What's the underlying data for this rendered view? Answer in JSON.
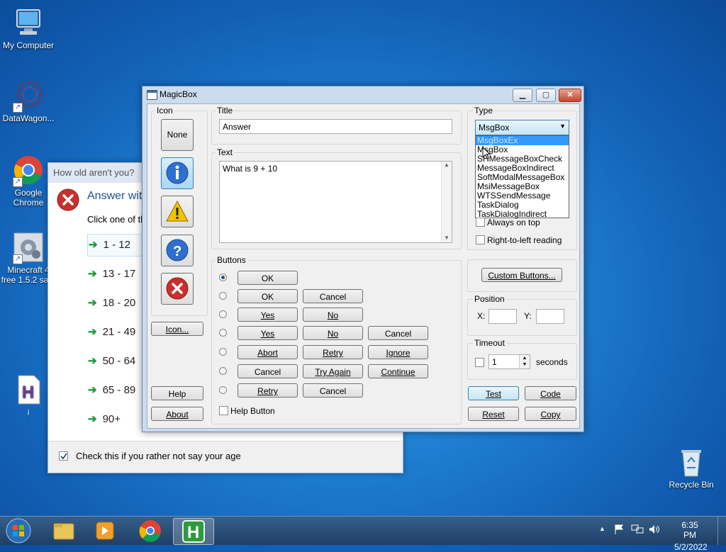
{
  "desktop": {
    "icons": [
      {
        "label": "My Computer"
      },
      {
        "label": "DataWagon..."
      },
      {
        "label": "Google Chrome"
      },
      {
        "label": "Minecraft 4 free 1.5.2 sa..."
      },
      {
        "label": "i"
      },
      {
        "label": "Recycle Bin"
      }
    ]
  },
  "age_dialog": {
    "title": "How old aren't you?",
    "heading": "Answer wit",
    "instruction": "Click one of th",
    "options": [
      "1 - 12",
      "13 - 17",
      "18 - 20",
      "21 - 49",
      "50 - 64",
      "65 - 89",
      "90+"
    ],
    "checkbox_label": "Check this if you rather not say your age"
  },
  "magicbox": {
    "title": "MagicBox",
    "icon_group": "Icon",
    "icon_none": "None",
    "icon_browse": "Icon...",
    "help": "Help",
    "about": "About",
    "title_label": "Title",
    "title_value": "Answer",
    "text_label": "Text",
    "text_value": "What is 9 + 10",
    "buttons_group": "Buttons",
    "button_rows": [
      [
        "OK"
      ],
      [
        "OK",
        "Cancel"
      ],
      [
        "Yes",
        "No"
      ],
      [
        "Yes",
        "No",
        "Cancel"
      ],
      [
        "Abort",
        "Retry",
        "Ignore"
      ],
      [
        "Cancel",
        "Try Again",
        "Continue"
      ],
      [
        "Retry",
        "Cancel"
      ]
    ],
    "help_button_label": "Help Button",
    "type_label": "Type",
    "type_selected": "MsgBox",
    "type_options": [
      "MsgBoxEx",
      "MsgBox",
      "SHMessageBoxCheck",
      "MessageBoxIndirect",
      "SoftModalMessageBox",
      "MsiMessageBox",
      "WTSSendMessage",
      "TaskDialog",
      "TaskDialogIndirect"
    ],
    "always_on_top": "Always on top",
    "rtl_reading": "Right-to-left reading",
    "custom_buttons": "Custom Buttons...",
    "position_label": "Position",
    "x_label": "X:",
    "y_label": "Y:",
    "timeout_label": "Timeout",
    "timeout_value": "1",
    "seconds_label": "seconds",
    "test": "Test",
    "code": "Code",
    "reset": "Reset",
    "copy": "Copy"
  },
  "taskbar": {
    "time": "6:35 PM",
    "date": "5/2/2022"
  }
}
